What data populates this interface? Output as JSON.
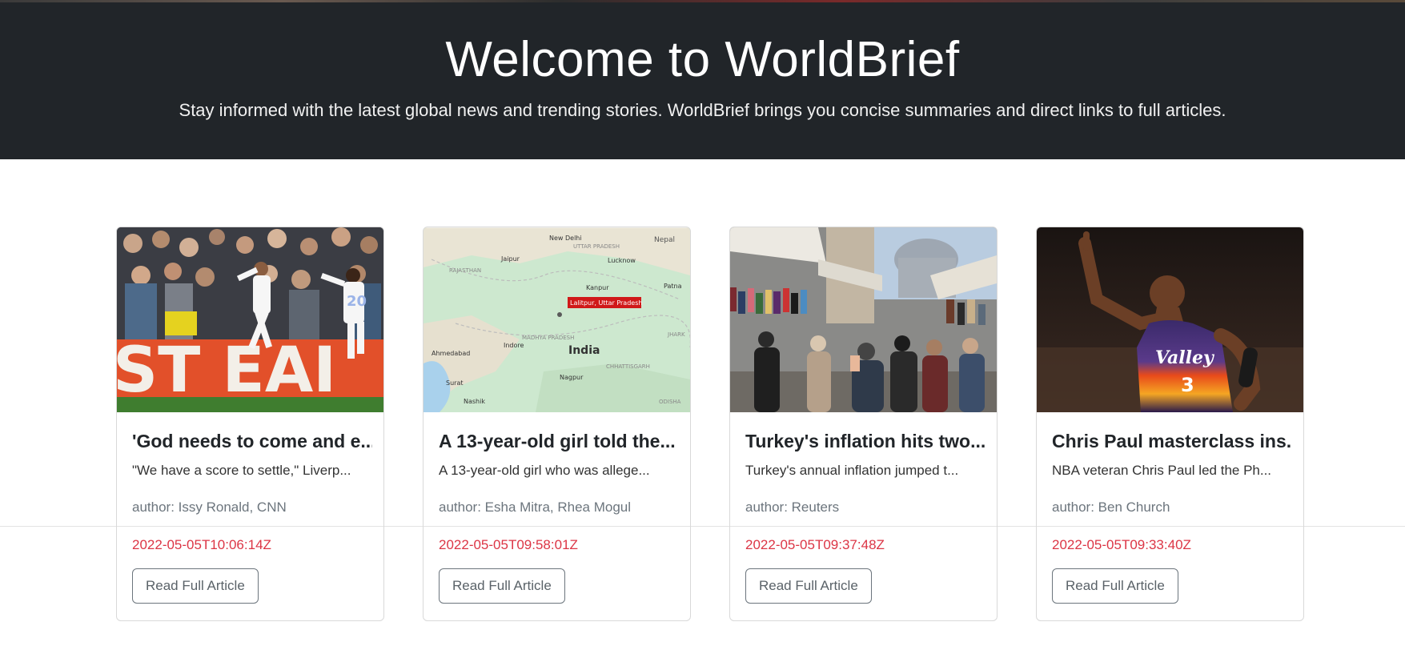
{
  "hero": {
    "title": "Welcome to WorldBrief",
    "subtitle": "Stay informed with the latest global news and trending stories. WorldBrief brings you concise summaries and direct links to full articles."
  },
  "articles": [
    {
      "image": "football-celebration-photo",
      "title": "'God needs to come and e...",
      "description": "\"We have a score to settle,\" Liverp...",
      "author": "author: Issy Ronald, CNN",
      "date": "2022-05-05T10:06:14Z",
      "button": "Read Full Article"
    },
    {
      "image": "india-map-photo",
      "title": "A 13-year-old girl told the...",
      "description": "A 13-year-old girl who was allege...",
      "author": "author: Esha Mitra, Rhea Mogul",
      "date": "2022-05-05T09:58:01Z",
      "button": "Read Full Article",
      "map_labels": {
        "marker": "Lalitpur, Uttar Pradesh",
        "country": "India",
        "cities": [
          "New Delhi",
          "Lucknow",
          "Jaipur",
          "Kanpur",
          "Indore",
          "Nagpur",
          "Ahmedabad",
          "Surat",
          "Nashik",
          "Patna"
        ],
        "regions": [
          "UTTAR PRADESH",
          "RAJASTHAN",
          "MADHYA PRADESH",
          "CHHATTISGARH",
          "JHARK",
          "ODISHA",
          "Nepal"
        ]
      }
    },
    {
      "image": "turkey-market-photo",
      "title": "Turkey's inflation hits two...",
      "description": "Turkey's annual inflation jumped t...",
      "author": "author: Reuters",
      "date": "2022-05-05T09:37:48Z",
      "button": "Read Full Article"
    },
    {
      "image": "basketball-player-photo",
      "title": "Chris Paul masterclass ins...",
      "description": "NBA veteran Chris Paul led the Ph...",
      "author": "author: Ben Church",
      "date": "2022-05-05T09:33:40Z",
      "button": "Read Full Article",
      "jersey": {
        "text": "Valley",
        "number": "3"
      }
    }
  ]
}
